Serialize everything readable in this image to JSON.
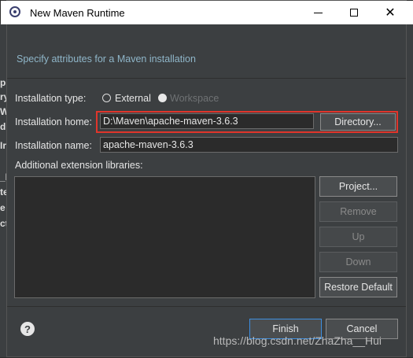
{
  "window": {
    "title": "New Maven Runtime"
  },
  "background_glyphs": [
    "p",
    "ry",
    "W",
    "di",
    "Ir",
    "_L",
    "te",
    "e",
    "ct"
  ],
  "header": {
    "text": "Specify attributes for a Maven installation"
  },
  "form": {
    "installation_type_label": "Installation type:",
    "external_label": "External",
    "workspace_label": "Workspace",
    "selected_type": "External",
    "installation_home_label": "Installation home:",
    "installation_home_value": "D:\\Maven\\apache-maven-3.6.3",
    "directory_button": "Directory...",
    "installation_name_label": "Installation name:",
    "installation_name_value": "apache-maven-3.6.3",
    "extension_libraries_label": "Additional extension libraries:"
  },
  "library_buttons": {
    "project": "Project...",
    "remove": "Remove",
    "up": "Up",
    "down": "Down",
    "restore_default": "Restore Default"
  },
  "footer": {
    "finish": "Finish",
    "cancel": "Cancel"
  },
  "watermark": "https://blog.csdn.net/ZhaZha__Hui",
  "icons": {
    "help": "?"
  },
  "colors": {
    "highlight": "#e0352b",
    "header_text": "#8fb6c9",
    "focus_border": "#3d8ee0"
  }
}
